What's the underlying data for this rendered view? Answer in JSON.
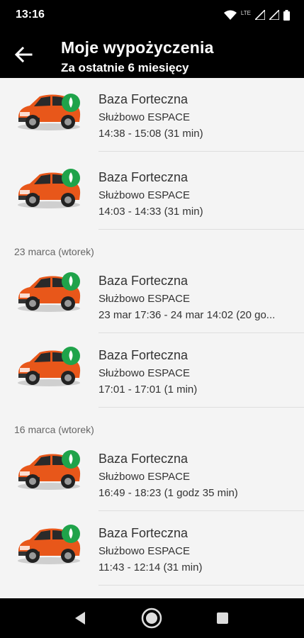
{
  "status": {
    "time": "13:16",
    "network": "LTE"
  },
  "header": {
    "title": "Moje wypożyczenia",
    "subtitle": "Za ostatnie 6 miesięcy"
  },
  "rentals": [
    {
      "location": "Baza Forteczna",
      "type": "Służbowo ESPACE",
      "time": "14:38 - 15:08 (31 min)"
    },
    {
      "location": "Baza Forteczna",
      "type": "Służbowo ESPACE",
      "time": "14:03 - 14:33 (31 min)"
    },
    {
      "location": "Baza Forteczna",
      "type": "Służbowo ESPACE",
      "time": "23 mar 17:36 - 24 mar 14:02 (20 go..."
    },
    {
      "location": "Baza Forteczna",
      "type": "Służbowo ESPACE",
      "time": "17:01 - 17:01 (1 min)"
    },
    {
      "location": "Baza Forteczna",
      "type": "Służbowo ESPACE",
      "time": "16:49 - 18:23 (1 godz 35 min)"
    },
    {
      "location": "Baza Forteczna",
      "type": "Służbowo ESPACE",
      "time": "11:43 - 12:14 (31 min)"
    }
  ],
  "date_headers": [
    "23 marca (wtorek)",
    "16 marca (wtorek)"
  ],
  "colors": {
    "badge": "#1fa34a",
    "car_body": "#e8571a",
    "app_bar": "#000000"
  },
  "icons": {
    "back": "arrow-left-icon",
    "badge": "leaf-icon",
    "nav_back": "triangle-back-icon",
    "nav_home": "circle-home-icon",
    "nav_recents": "square-recents-icon"
  }
}
